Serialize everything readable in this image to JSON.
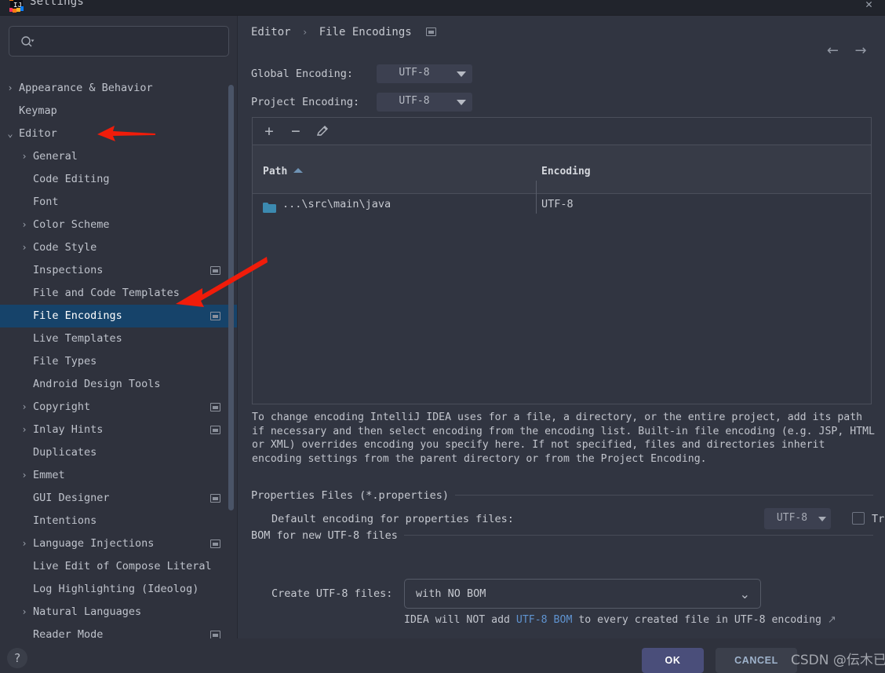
{
  "window": {
    "title": "Settings",
    "close_label": "✕",
    "app_icon": "intellij-idea-icon"
  },
  "sidebar": {
    "search": {
      "placeholder": "",
      "value": "",
      "icon": "search-icon"
    },
    "items": [
      {
        "label": "Appearance & Behavior",
        "depth": 0,
        "chevron": "›",
        "badge": false,
        "selected": false
      },
      {
        "label": "Keymap",
        "depth": 0,
        "chevron": "",
        "badge": false,
        "selected": false
      },
      {
        "label": "Editor",
        "depth": 0,
        "chevron": "⌄",
        "badge": false,
        "selected": false
      },
      {
        "label": "General",
        "depth": 1,
        "chevron": "›",
        "badge": false,
        "selected": false
      },
      {
        "label": "Code Editing",
        "depth": 1,
        "chevron": "",
        "badge": false,
        "selected": false
      },
      {
        "label": "Font",
        "depth": 1,
        "chevron": "",
        "badge": false,
        "selected": false
      },
      {
        "label": "Color Scheme",
        "depth": 1,
        "chevron": "›",
        "badge": false,
        "selected": false
      },
      {
        "label": "Code Style",
        "depth": 1,
        "chevron": "›",
        "badge": false,
        "selected": false
      },
      {
        "label": "Inspections",
        "depth": 1,
        "chevron": "",
        "badge": true,
        "selected": false
      },
      {
        "label": "File and Code Templates",
        "depth": 1,
        "chevron": "",
        "badge": false,
        "selected": false
      },
      {
        "label": "File Encodings",
        "depth": 1,
        "chevron": "",
        "badge": true,
        "selected": true
      },
      {
        "label": "Live Templates",
        "depth": 1,
        "chevron": "",
        "badge": false,
        "selected": false
      },
      {
        "label": "File Types",
        "depth": 1,
        "chevron": "",
        "badge": false,
        "selected": false
      },
      {
        "label": "Android Design Tools",
        "depth": 1,
        "chevron": "",
        "badge": false,
        "selected": false
      },
      {
        "label": "Copyright",
        "depth": 1,
        "chevron": "›",
        "badge": true,
        "selected": false
      },
      {
        "label": "Inlay Hints",
        "depth": 1,
        "chevron": "›",
        "badge": true,
        "selected": false
      },
      {
        "label": "Duplicates",
        "depth": 1,
        "chevron": "",
        "badge": false,
        "selected": false
      },
      {
        "label": "Emmet",
        "depth": 1,
        "chevron": "›",
        "badge": false,
        "selected": false
      },
      {
        "label": "GUI Designer",
        "depth": 1,
        "chevron": "",
        "badge": true,
        "selected": false
      },
      {
        "label": "Intentions",
        "depth": 1,
        "chevron": "",
        "badge": false,
        "selected": false
      },
      {
        "label": "Language Injections",
        "depth": 1,
        "chevron": "›",
        "badge": true,
        "selected": false
      },
      {
        "label": "Live Edit of Compose Literal",
        "depth": 1,
        "chevron": "",
        "badge": false,
        "selected": false
      },
      {
        "label": "Log Highlighting (Ideolog)",
        "depth": 1,
        "chevron": "",
        "badge": false,
        "selected": false
      },
      {
        "label": "Natural Languages",
        "depth": 1,
        "chevron": "›",
        "badge": false,
        "selected": false
      },
      {
        "label": "Reader Mode",
        "depth": 1,
        "chevron": "",
        "badge": true,
        "selected": false
      }
    ]
  },
  "content": {
    "breadcrumb": {
      "parent": "Editor",
      "separator": "›",
      "current": "File Encodings"
    },
    "nav": {
      "back": "←",
      "forward": "→"
    },
    "global_encoding": {
      "label": "Global Encoding:",
      "value": "UTF-8"
    },
    "project_encoding": {
      "label": "Project Encoding:",
      "value": "UTF-8"
    },
    "table": {
      "toolbar": {
        "add": "+",
        "remove": "−",
        "edit": "edit-pencil-icon"
      },
      "columns": [
        "Path",
        "Encoding"
      ],
      "sort_column": "Path",
      "sort_direction": "ascending",
      "rows": [
        {
          "icon": "folder-icon",
          "path": "...\\src\\main\\java",
          "encoding": "UTF-8"
        }
      ]
    },
    "description": "To change encoding IntelliJ IDEA uses for a file, a directory, or the entire project, add its path if necessary and then select encoding from the encoding list. Built-in file encoding (e.g. JSP, HTML or XML) overrides encoding you specify here. If not specified, files and directories inherit encoding settings from the parent directory or from the Project Encoding.",
    "properties_section": {
      "title": "Properties Files (*.properties)",
      "default_encoding_label": "Default encoding for properties files:",
      "default_encoding_value": "UTF-8",
      "transparent_label": "Transparent native-to-ascii conversion",
      "transparent_checked": false
    },
    "bom_section": {
      "title": "BOM for new UTF-8 files",
      "create_label": "Create UTF-8 files:",
      "create_value": "with NO BOM",
      "hint_prefix": "IDEA will NOT add ",
      "hint_link": "UTF-8 BOM",
      "hint_suffix": " to every created file in UTF-8 encoding ",
      "hint_external_icon": "↗"
    }
  },
  "footer": {
    "help": "?",
    "ok": "OK",
    "cancel": "CANCEL",
    "watermark": "CSDN @伝木已"
  },
  "colors": {
    "window_bg": "#2b2e39",
    "sidebar_bg": "#2f323d",
    "content_bg": "#313541",
    "selected_item": "#16436a",
    "accent_button": "#4a4e7a",
    "link": "#5f93d0",
    "folder": "#3c8ab0",
    "annotation_arrow": "#f01c0a"
  }
}
